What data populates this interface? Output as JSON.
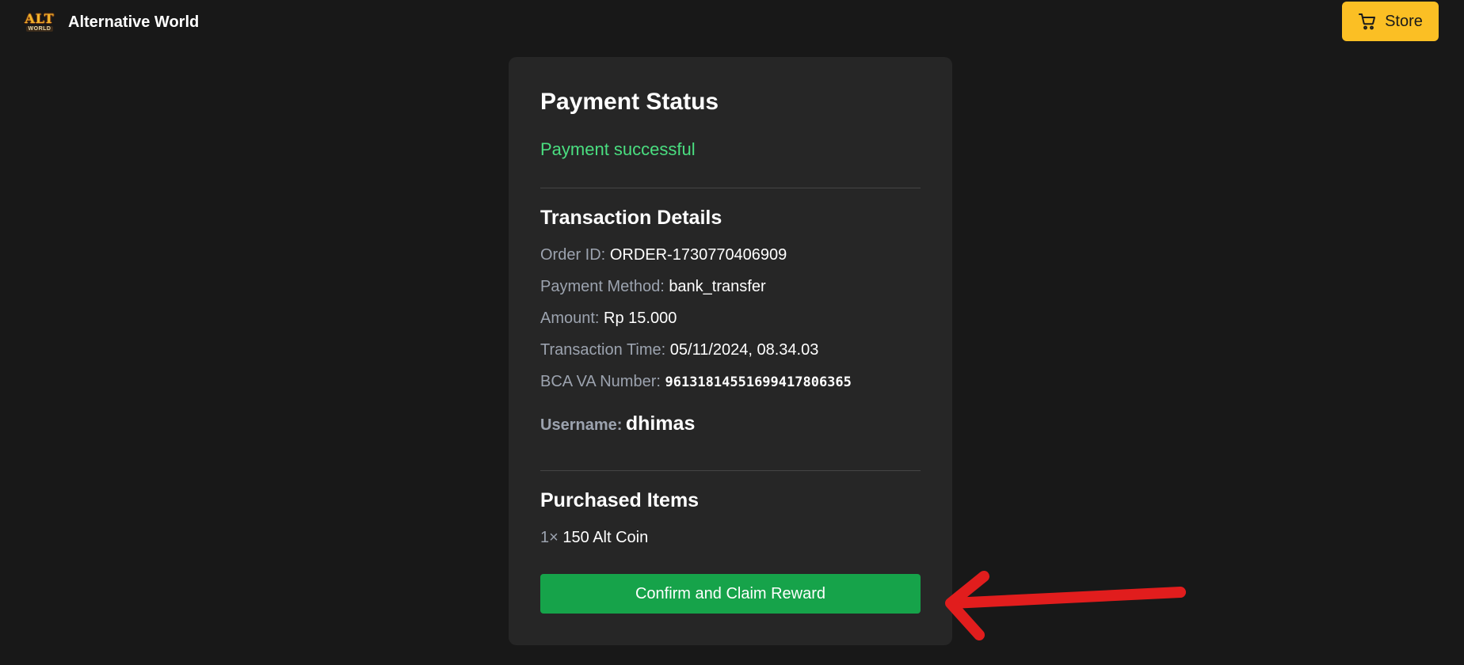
{
  "header": {
    "logo_top": "ALT",
    "logo_bottom": "WORLD",
    "brand_name": "Alternative World",
    "store_label": "Store",
    "store_icon": "cart-icon"
  },
  "card": {
    "title": "Payment Status",
    "status": "Payment successful",
    "transaction": {
      "heading": "Transaction Details",
      "order_id_label": "Order ID:",
      "order_id": "ORDER-1730770406909",
      "payment_method_label": "Payment Method:",
      "payment_method": "bank_transfer",
      "amount_label": "Amount:",
      "amount": "Rp 15.000",
      "time_label": "Transaction Time:",
      "time": "05/11/2024, 08.34.03",
      "va_label": "BCA VA Number:",
      "va_number": "96131814551699417806365",
      "username_label": "Username:",
      "username": "dhimas"
    },
    "purchased": {
      "heading": "Purchased Items",
      "items": [
        {
          "qty": "1×",
          "name": "150 Alt Coin"
        }
      ]
    },
    "claim_label": "Confirm and Claim Reward"
  },
  "colors": {
    "background": "#181818",
    "card": "#262626",
    "success": "#4ade80",
    "claim_button": "#16a34a",
    "store_button": "#fbbf24",
    "annotation_arrow": "#e11d1d"
  }
}
